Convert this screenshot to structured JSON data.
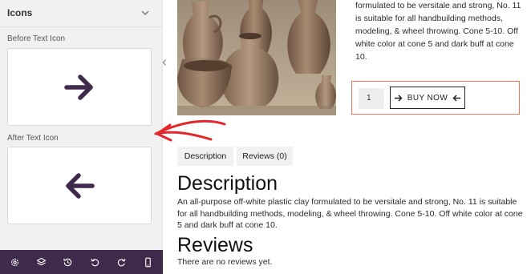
{
  "panel": {
    "title": "Icons",
    "before_label": "Before Text Icon",
    "after_label": "After Text Icon",
    "before_icon": "arrow-right-icon",
    "after_icon": "arrow-left-icon",
    "icon_color": "#3f2a4b",
    "toolbar": [
      "gear-icon",
      "layers-icon",
      "history-icon",
      "undo-icon",
      "redo-icon",
      "mobile-preview-icon"
    ]
  },
  "annotation": {
    "color": "#e3262b"
  },
  "product": {
    "description_snippet": "formulated to be versitale and strong, No. 11 is suitable for all handbuilding methods, modeling, & wheel throwing. Cone 5-10. Off white color at cone 5 and dark buff at cone 10.",
    "quantity": "1",
    "buy_label": "BUY NOW",
    "buy_box_border_color": "#ea7a5a"
  },
  "tabs": [
    {
      "label": "Description"
    },
    {
      "label": "Reviews (0)"
    }
  ],
  "description": {
    "heading": "Description",
    "text": "An all-purpose off-white plastic clay formulated to be versitale and strong, No. 11 is suitable for all handbuilding methods, modeling, & wheel throwing. Cone 5-10. Off white color at cone 5 and dark buff at cone 10."
  },
  "reviews": {
    "heading": "Reviews",
    "empty_text": "There are no reviews yet."
  }
}
